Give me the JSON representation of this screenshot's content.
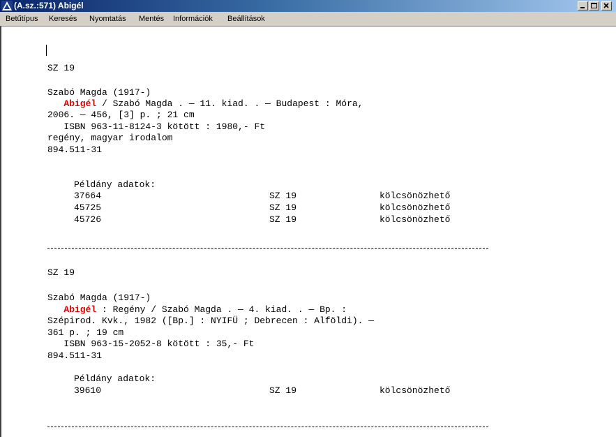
{
  "window": {
    "title": "(A.sz.:571) Abigél"
  },
  "menu": [
    "Betűtípus",
    "Keresés",
    "Nyomtatás",
    "Mentés",
    "Információk",
    "Beállítások"
  ],
  "records": [
    {
      "shelfmark": "SZ 19",
      "author": "Szabó Magda (1917-)",
      "title_highlight": "Abigél",
      "desc_line1_rest": " / Szabó Magda . — 11. kiad. . — Budapest : Móra,",
      "desc_line2": "2006. — 456, [3] p. ; 21 cm",
      "desc_line3": "   ISBN 963-11-8124-3 kötött : 1980,- Ft",
      "subject": "regény, magyar irodalom",
      "classification": "894.511-31",
      "copies_header": "Példány adatok:",
      "copies": [
        {
          "id": "37664",
          "shelf": "SZ 19",
          "status": "kölcsönözhető"
        },
        {
          "id": "45725",
          "shelf": "SZ 19",
          "status": "kölcsönözhető"
        },
        {
          "id": "45726",
          "shelf": "SZ 19",
          "status": "kölcsönözhető"
        }
      ]
    },
    {
      "shelfmark": "SZ 19",
      "author": "Szabó Magda (1917-)",
      "title_highlight": "Abigél",
      "desc_line1_rest": " : Regény / Szabó Magda . — 4. kiad. . — Bp. :",
      "desc_line2": "Szépirod. Kvk., 1982 ([Bp.] : NYIFÜ ; Debrecen : Alföldi). —",
      "desc_line2b": "361 p. ; 19 cm",
      "desc_line3": "   ISBN 963-15-2052-8 kötött : 35,- Ft",
      "classification": "894.511-31",
      "copies_header": "Példány adatok:",
      "copies": [
        {
          "id": "39610",
          "shelf": "SZ 19",
          "status": "kölcsönözhető"
        }
      ]
    }
  ]
}
